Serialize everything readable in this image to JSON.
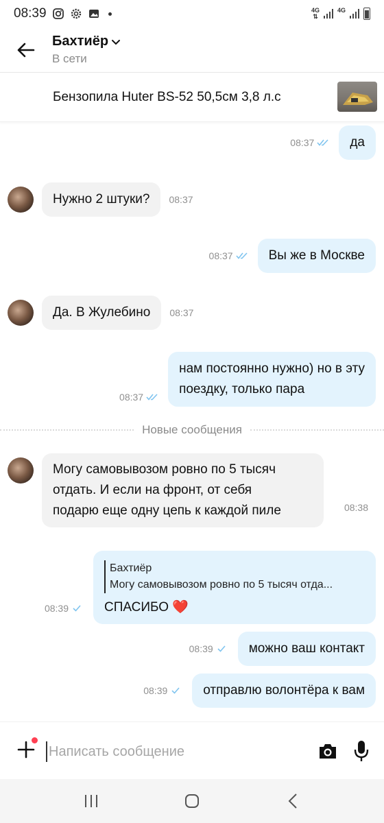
{
  "status_bar": {
    "time": "08:39",
    "net1": "4G",
    "net2": "4G"
  },
  "header": {
    "contact_name": "Бахтиёр",
    "contact_status": "В сети"
  },
  "listing": {
    "title": "Бензопила Huter BS-52 50,5см 3,8 л.с"
  },
  "messages": [
    {
      "dir": "out",
      "text": "да",
      "time": "08:37"
    },
    {
      "dir": "in",
      "text": "Нужно 2 штуки?",
      "time": "08:37"
    },
    {
      "dir": "out",
      "text": "Вы же в Москве",
      "time": "08:37"
    },
    {
      "dir": "in",
      "text": "Да. В Жулебино",
      "time": "08:37"
    },
    {
      "dir": "out",
      "lines": [
        "нам постоянно нужно) но в эту",
        "поездку, только пара"
      ],
      "time": "08:37"
    },
    {
      "dir": "in",
      "lines": [
        "Могу самовывозом ровно по 5 тысяч",
        "отдать. И если на фронт, от себя",
        "подарю еще одну цепь к каждой пиле"
      ],
      "time": "08:38"
    },
    {
      "dir": "out",
      "reply_author": "Бахтиёр",
      "reply_text": "Могу самовывозом ровно по 5 тысяч отда...",
      "text": "СПАСИБО ❤️",
      "time": "08:39"
    },
    {
      "dir": "out",
      "text": "можно ваш контакт",
      "time": "08:39"
    },
    {
      "dir": "out",
      "text": "отправлю волонтёра к вам",
      "time": "08:39"
    }
  ],
  "divider": {
    "label": "Новые сообщения"
  },
  "composer": {
    "placeholder": "Написать сообщение"
  },
  "colors": {
    "incoming_bubble": "#f2f2f2",
    "outgoing_bubble": "#e3f3fd",
    "read_ticks": "#7fc4ef",
    "notification_dot": "#ff4053"
  },
  "icons": {
    "back": "arrow-left-icon",
    "dropdown": "chevron-down-icon",
    "attach": "plus-icon",
    "camera": "camera-icon",
    "mic": "microphone-icon",
    "nav_recent": "recent-apps-icon",
    "nav_home": "home-icon",
    "nav_back": "nav-back-icon"
  }
}
